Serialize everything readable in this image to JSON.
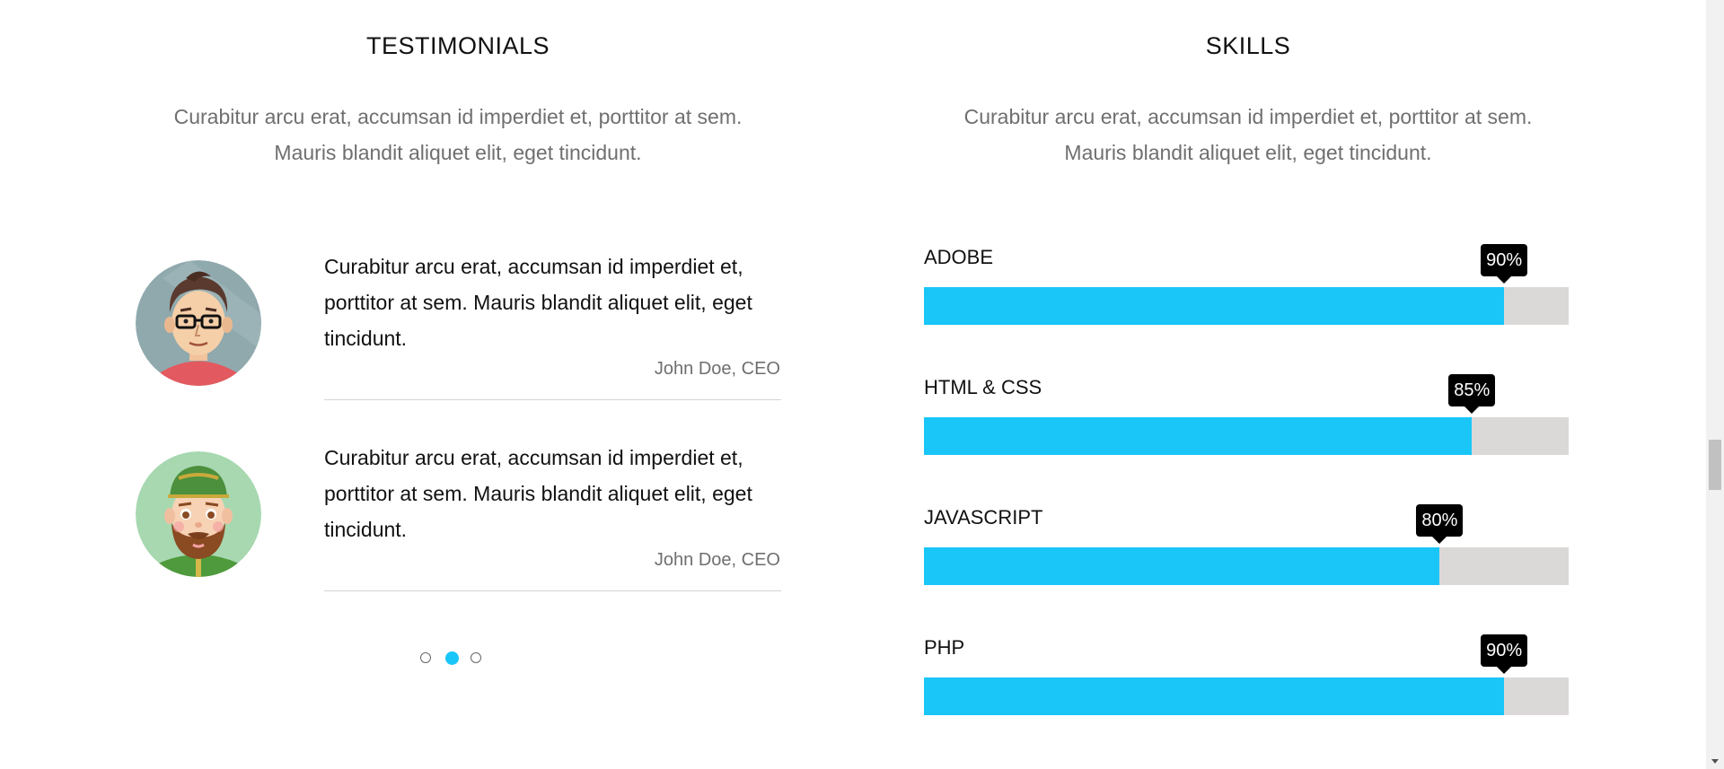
{
  "testimonials": {
    "title": "TESTIMONIALS",
    "subtitle_line1": "Curabitur arcu erat, accumsan id imperdiet et, porttitor at sem.",
    "subtitle_line2": "Mauris blandit aliquet elit, eget tincidunt.",
    "items": [
      {
        "text": "Curabitur arcu erat, accumsan id imperdiet et, porttitor at sem. Mauris blandit aliquet elit, eget tincidunt.",
        "author": "John Doe, CEO",
        "avatar_icon": "man-with-glasses-avatar-icon"
      },
      {
        "text": "Curabitur arcu erat, accumsan id imperdiet et, porttitor at sem. Mauris blandit aliquet elit, eget tincidunt.",
        "author": "John Doe, CEO",
        "avatar_icon": "bearded-man-with-cap-avatar-icon"
      }
    ],
    "pagination": {
      "count": 3,
      "active_index": 1
    }
  },
  "skills": {
    "title": "SKILLS",
    "subtitle_line1": "Curabitur arcu erat, accumsan id imperdiet et, porttitor at sem.",
    "subtitle_line2": "Mauris blandit aliquet elit, eget tincidunt.",
    "items": [
      {
        "label": "ADOBE",
        "percent": 90,
        "percent_text": "90%"
      },
      {
        "label": "HTML & CSS",
        "percent": 85,
        "percent_text": "85%"
      },
      {
        "label": "JAVASCRIPT",
        "percent": 80,
        "percent_text": "80%"
      },
      {
        "label": "PHP",
        "percent": 90,
        "percent_text": "90%"
      }
    ]
  },
  "colors": {
    "accent": "#1ac6f7",
    "bar_track": "#dbd8d8",
    "badge": "#000000",
    "muted_text": "#6f6f6f"
  }
}
